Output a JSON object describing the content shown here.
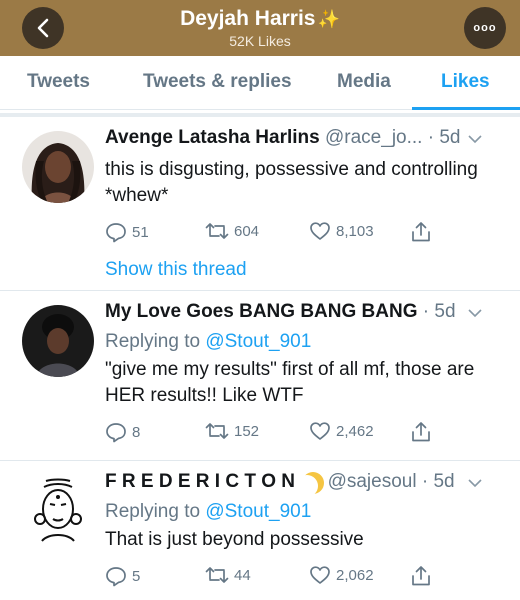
{
  "header": {
    "title": "Deyjah Harris",
    "sparkle": "✨",
    "subtitle": "52K Likes",
    "back_icon": "chevron-left-icon",
    "more_icon": "more-icon",
    "more_glyph": "ooo"
  },
  "tabs": [
    {
      "label": "Tweets"
    },
    {
      "label": "Tweets & replies"
    },
    {
      "label": "Media"
    },
    {
      "label": "Likes",
      "active": true
    }
  ],
  "tweets": [
    {
      "name": "Avenge Latasha Harlins",
      "handle": "@race_jo...",
      "time": "· 5d",
      "body": "this is disgusting, possessive and controlling *whew*",
      "replies": "51",
      "retweets": "604",
      "likes": "8,103",
      "show_thread": "Show this thread"
    },
    {
      "name": "My Love Goes BANG BANG BANG",
      "time": "· 5d",
      "replying_to_label": "Replying to",
      "replying_to": "@Stout_901",
      "body": "\"give me my results\" first of all mf, those are HER results!! Like WTF",
      "replies": "8",
      "retweets": "152",
      "likes": "2,462"
    },
    {
      "name": "F R E D E R I C T O N",
      "handle": "@sajesoul",
      "time": "· 5d",
      "replying_to_label": "Replying to",
      "replying_to": "@Stout_901",
      "body": "That is just beyond possessive",
      "replies": "5",
      "retweets": "44",
      "likes": "2,062"
    }
  ],
  "colors": {
    "header_bg": "#9b7a46",
    "accent": "#1da1f2",
    "muted": "#657786"
  }
}
